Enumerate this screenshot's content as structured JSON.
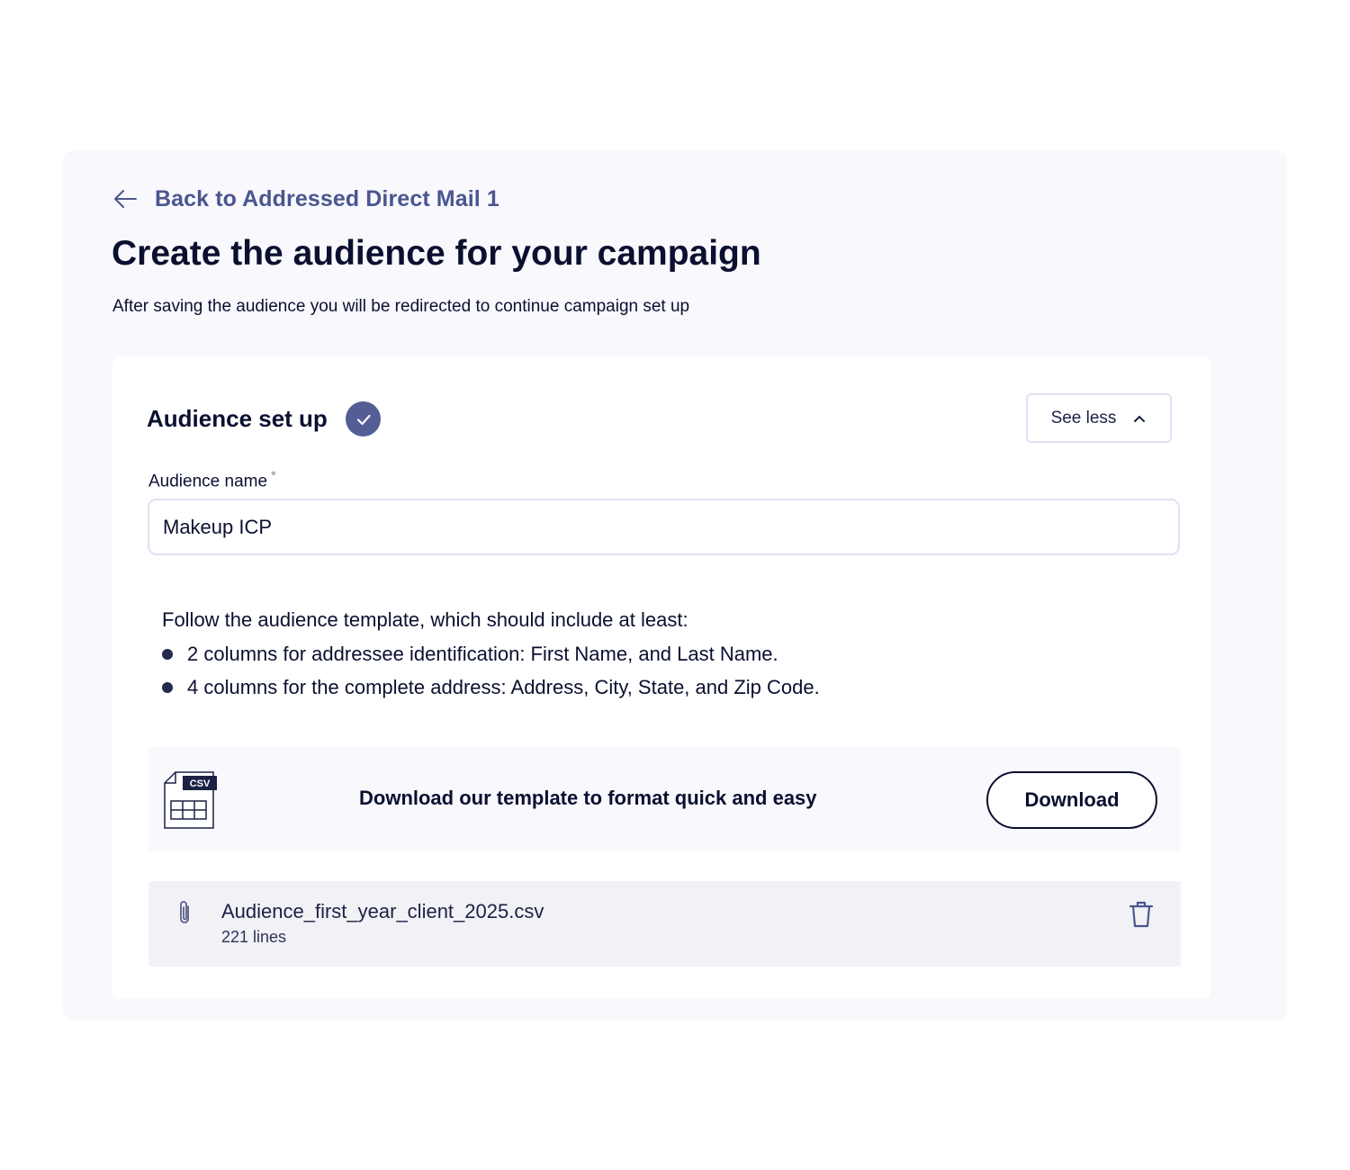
{
  "back_link": {
    "label": "Back to Addressed Direct Mail 1",
    "icon": "arrow-left-icon"
  },
  "page": {
    "title": "Create the audience for your campaign",
    "subtitle": "After saving the audience you will be redirected to continue campaign set up"
  },
  "audience_card": {
    "title": "Audience set up",
    "status_icon": "check-circle-icon",
    "toggle_label": "See less",
    "toggle_icon": "chevron-up-icon",
    "name_field": {
      "label": "Audience name",
      "required_mark": "*",
      "value": "Makeup ICP"
    },
    "instructions": {
      "intro": "Follow the audience template, which should include at least:",
      "items": [
        "2 columns for addressee identification: First Name, and Last Name.",
        "4 columns for the complete address: Address, City, State, and Zip Code."
      ]
    },
    "template": {
      "icon": "csv-file-icon",
      "icon_badge": "CSV",
      "text": "Download our template to format quick and easy",
      "button_label": "Download"
    },
    "uploaded_file": {
      "icon": "paperclip-icon",
      "name": "Audience_first_year_client_2025.csv",
      "lines": "221 lines",
      "delete_icon": "trash-icon"
    }
  },
  "colors": {
    "accent": "#535d96",
    "link": "#4b568f",
    "text": "#0b1030",
    "panel_bg": "#f8f8fd",
    "file_row_bg": "#f1f1f6"
  }
}
